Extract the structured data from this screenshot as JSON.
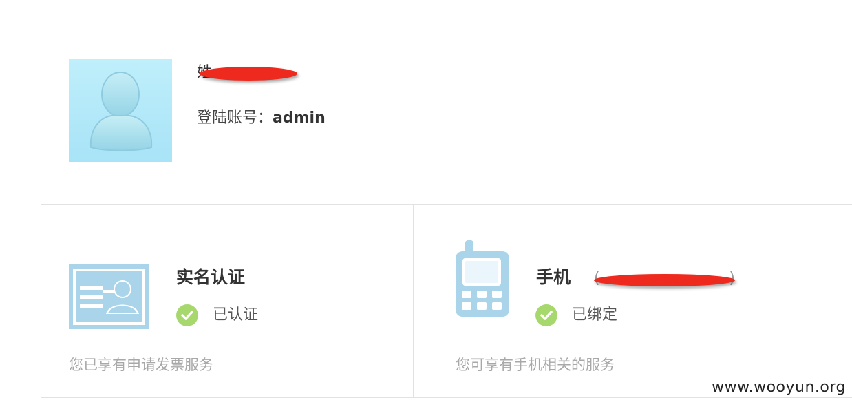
{
  "profile": {
    "name_visible_char": "姓",
    "account_label": "登陆账号：",
    "account_value": "admin",
    "avatar_icon": "user-avatar-icon"
  },
  "cards": {
    "realname": {
      "title": "实名认证",
      "status": "已认证",
      "description": "您已享有申请发票服务",
      "icon": "id-card-icon"
    },
    "phone": {
      "title": "手机",
      "phone_masked": "(",
      "phone_masked_end": ")",
      "status": "已绑定",
      "description": "您可享有手机相关的服务",
      "icon": "mobile-phone-icon"
    }
  },
  "watermark": "www.wooyun.org",
  "colors": {
    "check_green": "#a7d86d",
    "icon_blue": "#a9d4ea",
    "redaction_red": "#ee2a1f"
  }
}
